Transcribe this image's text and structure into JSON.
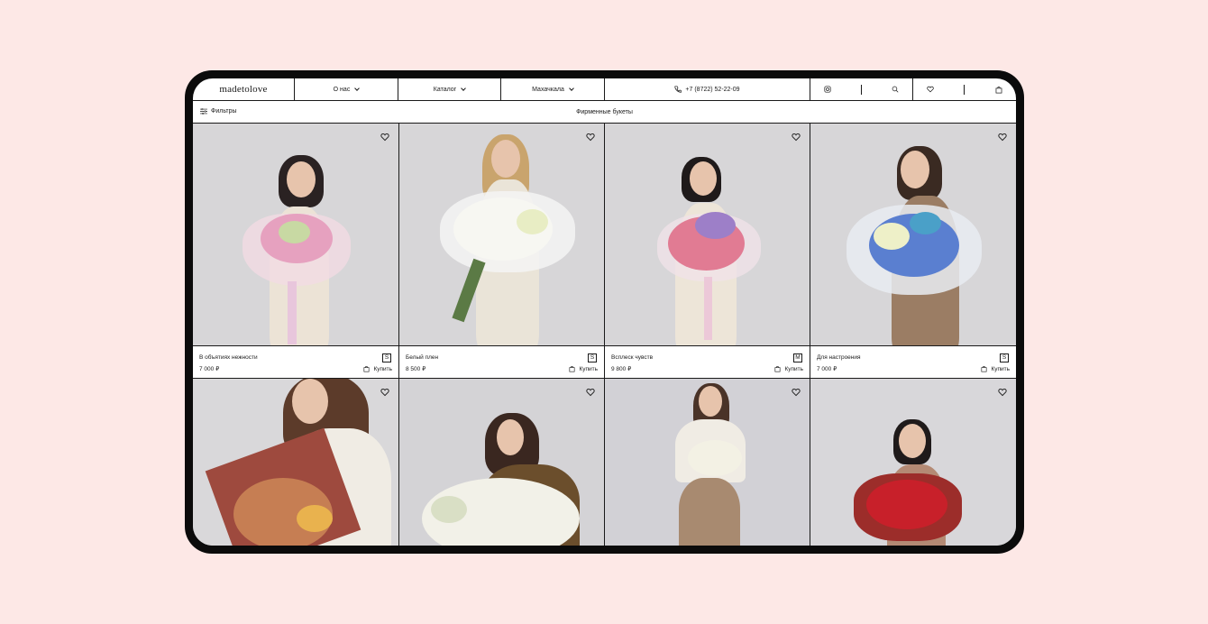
{
  "header": {
    "logo": "madetolove",
    "nav": [
      {
        "label": "О нас"
      },
      {
        "label": "Каталог"
      },
      {
        "label": "Махачкала"
      }
    ],
    "phone": "+7 (8722) 52-22-09"
  },
  "subbar": {
    "filters_label": "Фильтры",
    "title": "Фирменные букеты"
  },
  "products": [
    {
      "name": "В объятиях нежности",
      "price": "7 000 ₽",
      "size": "S",
      "buy_label": "Купить"
    },
    {
      "name": "Белый плен",
      "price": "8 500 ₽",
      "size": "S",
      "buy_label": "Купить"
    },
    {
      "name": "Всплеск чувств",
      "price": "9 800 ₽",
      "size": "M",
      "buy_label": "Купить"
    },
    {
      "name": "Для настроения",
      "price": "7 000 ₽",
      "size": "S",
      "buy_label": "Купить"
    }
  ],
  "icons": [
    "instagram-icon",
    "search-icon",
    "heart-icon",
    "bag-icon",
    "phone-icon",
    "filter-icon"
  ]
}
